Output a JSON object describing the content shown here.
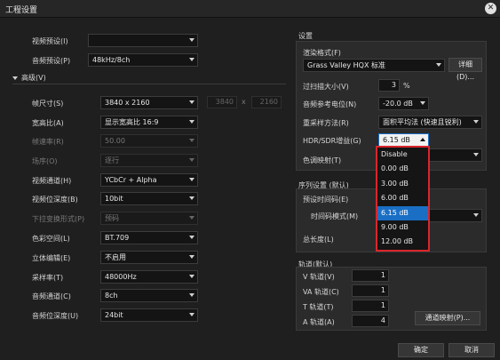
{
  "window": {
    "title": "工程设置"
  },
  "left": {
    "video_preset": {
      "label": "视频预设(I)",
      "value": ""
    },
    "audio_preset": {
      "label": "音频预设(P)",
      "value": "48kHz/8ch"
    },
    "advanced_label": "高级(V)",
    "frame_size": {
      "label": "帧尺寸(S)",
      "value": "3840 x 2160",
      "width": "3840",
      "x": "x",
      "height": "2160"
    },
    "aspect": {
      "label": "宽高比(A)",
      "value": "显示宽高比 16:9"
    },
    "frame_rate": {
      "label": "帧速率(R)",
      "value": "50.00"
    },
    "field_order": {
      "label": "场序(O)",
      "value": "逐行"
    },
    "video_channel": {
      "label": "视频通道(H)",
      "value": "YCbCr + Alpha"
    },
    "video_depth": {
      "label": "视频位深度(B)",
      "value": "10bit"
    },
    "pulldown": {
      "label": "下拉变换形式(P)",
      "value": "预码"
    },
    "color_space": {
      "label": "色彩空间(L)",
      "value": "BT.709"
    },
    "stereo": {
      "label": "立体编辑(E)",
      "value": "不启用"
    },
    "sample_rate": {
      "label": "采样率(T)",
      "value": "48000Hz"
    },
    "audio_channel": {
      "label": "音频通道(C)",
      "value": "8ch"
    },
    "audio_depth": {
      "label": "音频位深度(U)",
      "value": "24bit"
    }
  },
  "settings": {
    "header": "设置",
    "render_format": {
      "label": "渲染格式(F)",
      "value": "Grass Valley HQX 标准",
      "detail": "详细(D)..."
    },
    "overscan": {
      "label": "过扫描大小(V)",
      "value": "3",
      "unit": "%"
    },
    "audio_ref": {
      "label": "音频参考电位(N)",
      "value": "-20.0 dB"
    },
    "resample": {
      "label": "重采样方法(R)",
      "value": "面积平均法 (快速且锐利)"
    },
    "hdr_gain": {
      "label": "HDR/SDR增益(G)",
      "value": "6.15 dB"
    },
    "tone_map": {
      "label": "色调映射(T)",
      "value": ""
    }
  },
  "dropdown": {
    "options": [
      "Disable",
      "0.00 dB",
      "3.00 dB",
      "6.00 dB",
      "6.15 dB",
      "9.00 dB",
      "12.00 dB"
    ],
    "selected": "6.15 dB"
  },
  "sequence": {
    "header": "序列设置 (默认)",
    "preset_time": {
      "label": "预设时间码(E)"
    },
    "timecode_mode": {
      "label": "时间码模式(M)"
    },
    "total_length": {
      "label": "总长度(L)"
    }
  },
  "tracks": {
    "header": "轨道(默认)",
    "v": {
      "label": "V 轨道(V)",
      "value": "1"
    },
    "va": {
      "label": "VA 轨道(C)",
      "value": "1"
    },
    "t": {
      "label": "T 轨道(T)",
      "value": "1"
    },
    "a": {
      "label": "A 轨道(A)",
      "value": "4"
    },
    "mapping": "通道映射(P)..."
  },
  "footer": {
    "ok": "确定",
    "cancel": "取消"
  }
}
